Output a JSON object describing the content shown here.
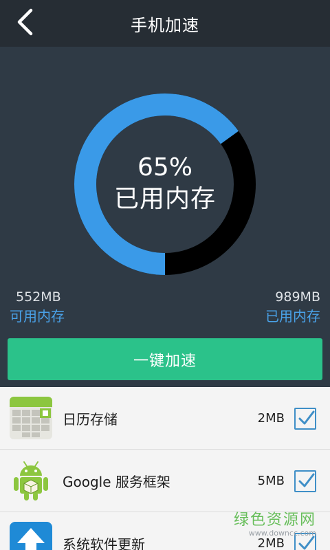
{
  "header": {
    "title": "手机加速"
  },
  "memory": {
    "used_percent": 65,
    "percent_text": "65%",
    "center_label": "已用内存",
    "available_value": "552MB",
    "available_label": "可用内存",
    "used_value": "989MB",
    "used_label": "已用内存"
  },
  "colors": {
    "used_arc": "#3a9ae8",
    "free_arc": "#000000",
    "accent": "#2bc28a"
  },
  "boost_button": {
    "label": "一键加速"
  },
  "apps": [
    {
      "name": "日历存储",
      "size": "2MB",
      "icon": "calendar-icon",
      "checked": true
    },
    {
      "name": "Google 服务框架",
      "size": "5MB",
      "icon": "android-icon",
      "checked": true
    },
    {
      "name": "系统软件更新",
      "size": "2MB",
      "icon": "update-arrow-icon",
      "checked": true
    }
  ],
  "watermark": {
    "main": "绿色资源网",
    "sub": "www.downcc.com"
  }
}
